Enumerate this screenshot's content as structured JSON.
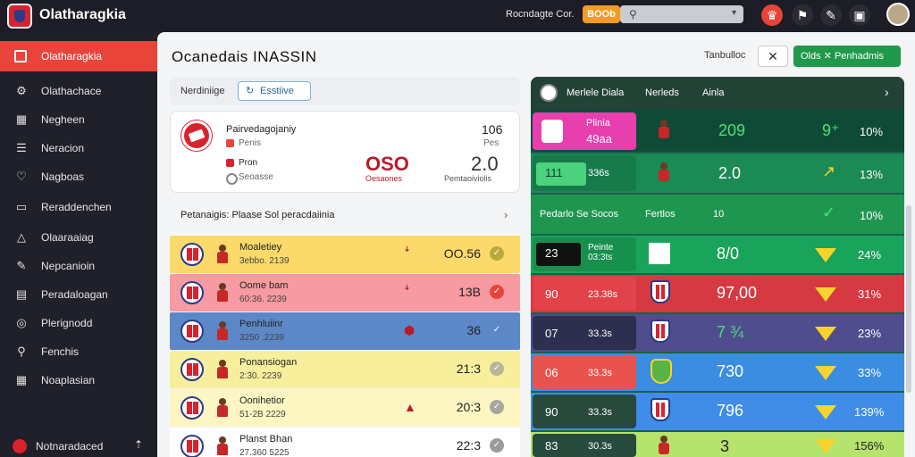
{
  "app": {
    "brand": "Olatharagkia",
    "top_link": "Rocndagte Cor.",
    "top_button": "BOOb"
  },
  "sidebar": {
    "active": "Olatharagkia",
    "items": [
      {
        "label": "Olathachace",
        "icon": "settings-icon"
      },
      {
        "label": "Negheen",
        "icon": "chart-icon"
      },
      {
        "label": "Neracion",
        "icon": "list-icon"
      },
      {
        "label": "Nagboas",
        "icon": "heart-icon"
      },
      {
        "label": "Reraddenchen",
        "icon": "calendar-icon"
      },
      {
        "label": "Olaaraaiag",
        "icon": "alert-icon"
      },
      {
        "label": "Nepcanioin",
        "icon": "edit-icon"
      },
      {
        "label": "Peradaloagan",
        "icon": "doc-icon"
      },
      {
        "label": "Plerignodd",
        "icon": "target-icon"
      },
      {
        "label": "Fenchis",
        "icon": "pin-icon"
      },
      {
        "label": "Noaplasian",
        "icon": "grid-icon"
      }
    ],
    "footer": "Notnaradaced"
  },
  "header": {
    "title": "Ocanedais INASSIN",
    "link": "Tanbulloc",
    "close": "✕",
    "green_button": "Olds   ✕   Penhadmis"
  },
  "filter": {
    "label": "Nerdiniige",
    "pill": "Esstiive"
  },
  "match": {
    "title": "Pairvedagojaniy",
    "sub": "Penis",
    "line3": "Pron",
    "line4": "Seoasse",
    "score": "OSO",
    "score_sub": "Oesaones",
    "right1": "106",
    "right2": "Pes",
    "score2": "2.0",
    "score2_sub": "Pemtaoiviolis"
  },
  "list": {
    "header": "Petanaigis:  Plaase  Sol peracdaiinia",
    "rows": [
      {
        "name": "Moaletiey",
        "sub": "3ebbo. 2139",
        "mid": "ꜜ",
        "val": "OO.56",
        "bg": "#fbd96a",
        "dot": "#b9a93b"
      },
      {
        "name": "Oome bam",
        "sub": "60:36. 2239",
        "mid": "ꜜ",
        "val": "13B",
        "bg": "#f79aa1",
        "dot": "#e8443a"
      },
      {
        "name": "Penhluiinr",
        "sub": "3250 .2239",
        "mid": "⬢",
        "val": "36",
        "bg": "#5d88c7",
        "dot": "#5d88c7"
      },
      {
        "name": "Ponansiogan",
        "sub": "2:30. 2239",
        "mid": "",
        "val": "21:3",
        "bg": "#f8ef9d",
        "dot": "#b9b59a"
      },
      {
        "name": "Oonihetior",
        "sub": "51-2B 2229",
        "mid": "▲",
        "val": "20:3",
        "bg": "#fdf6c3",
        "dot": "#a7a79f"
      },
      {
        "name": "Planst Bhan",
        "sub": "27.360 5225",
        "mid": "",
        "val": "22:3",
        "bg": "#ffffff",
        "dot": "#9b9b9b"
      }
    ]
  },
  "right_panel": {
    "head": [
      "Merlele Diala",
      "Nerleds",
      "Ainla"
    ],
    "rows": [
      {
        "left_title": "Plinia",
        "left_val": "49aa",
        "big": "209",
        "pct": "10%",
        "mark": "9⁺"
      },
      {
        "left_title": "111",
        "left_val": "336s",
        "big": "2.0",
        "pct": "13%",
        "mark": "↗"
      },
      {
        "left_title": "Pedarlo  Se Socos",
        "left_val": "Fertlos",
        "big": "10",
        "pct": "10%",
        "mark": "✓"
      },
      {
        "left_title": "23",
        "left_val": "Peinte 03:3ts",
        "big": "8/0",
        "pct": "24%",
        "mark": ""
      },
      {
        "left_title": "90",
        "left_val": "23.38s",
        "big": "97,00",
        "pct": "31%",
        "mark": ""
      },
      {
        "left_title": "07",
        "left_val": "33.3s",
        "big": "7 ¾",
        "pct": "23%",
        "mark": ""
      },
      {
        "left_title": "06",
        "left_val": "33.3s",
        "big": "730",
        "pct": "33%",
        "mark": ""
      },
      {
        "left_title": "90",
        "left_val": "33.3s",
        "big": "796",
        "pct": "139%",
        "mark": ""
      },
      {
        "left_title": "83",
        "left_val": "30.3s",
        "big": "3",
        "pct": "156%",
        "mark": ""
      }
    ]
  },
  "colors": {
    "accent": "#e8443a",
    "green": "#1f9a4a",
    "sidebar": "#1f2029"
  }
}
